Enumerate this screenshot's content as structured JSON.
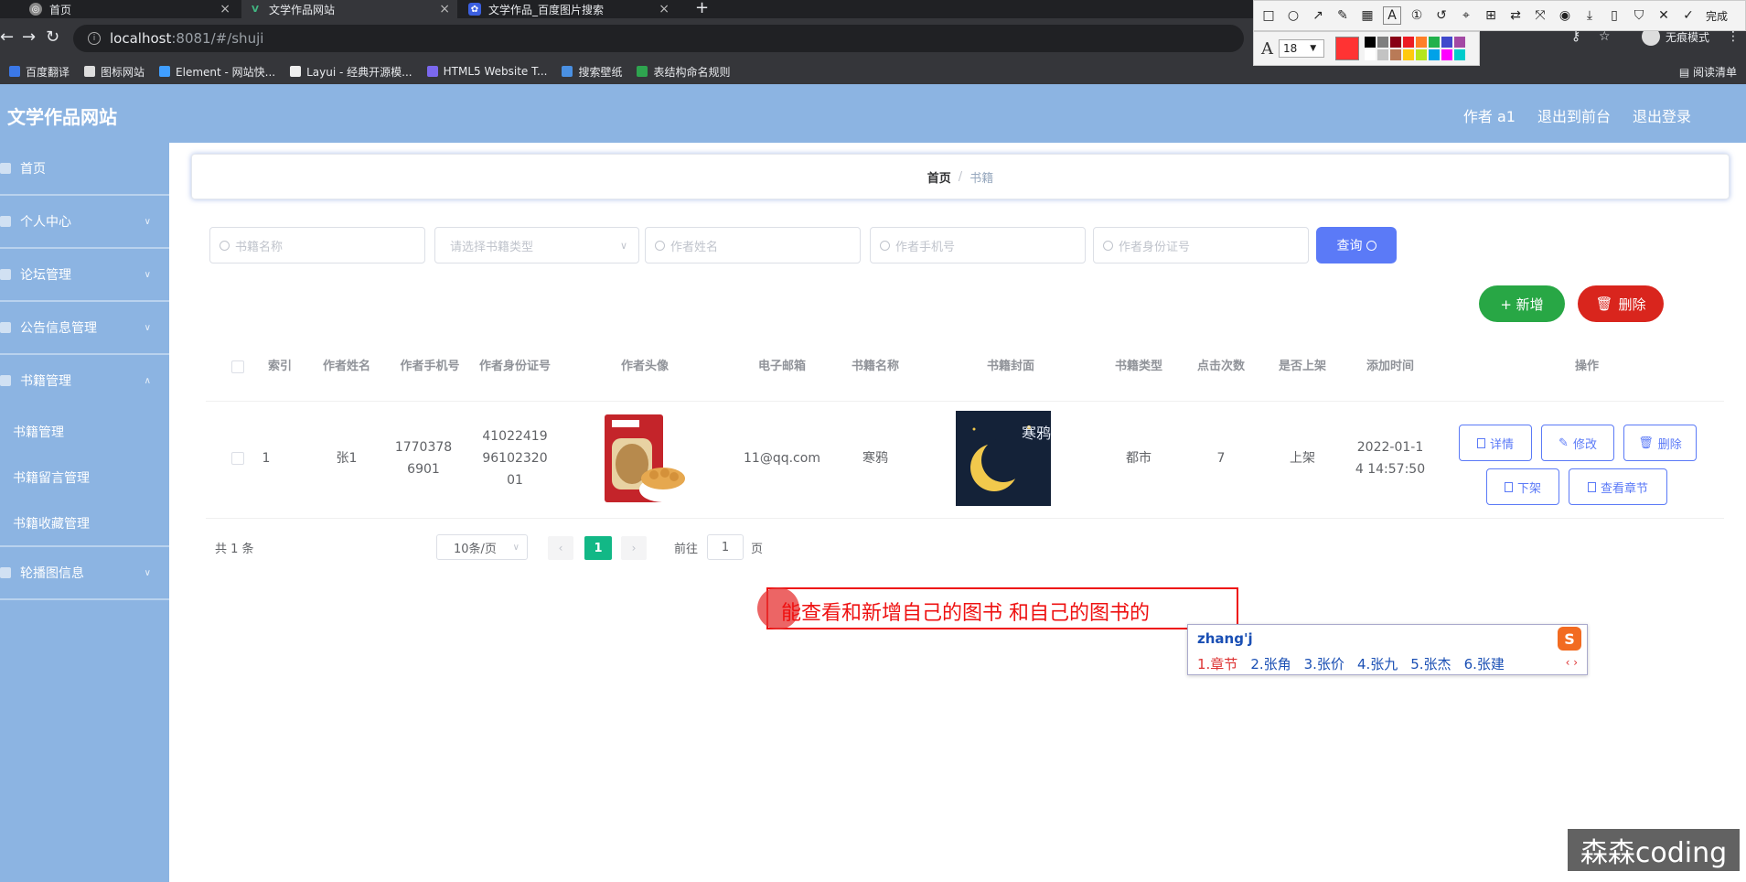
{
  "browser": {
    "tabs": [
      {
        "title": "首页",
        "active": false
      },
      {
        "title": "文学作品网站",
        "active": true
      },
      {
        "title": "文学作品_百度图片搜索",
        "active": false
      }
    ],
    "url_host": "localhost",
    "url_path": ":8081/#/shuji",
    "bookmarks": [
      "百度翻译",
      "图标网站",
      "Element - 网站快...",
      "Layui - 经典开源模...",
      "HTML5 Website T...",
      "搜索壁纸",
      "表结构命名规则"
    ],
    "reading_list": "阅读清单",
    "incognito_label": "无痕模式",
    "screenshot_tool": {
      "done_label": "完成",
      "font_size": "18",
      "current_color": "#ff3333",
      "palette": [
        "#000000",
        "#7f7f7f",
        "#880015",
        "#ed1c24",
        "#ff7f27",
        "#22b14c",
        "#3f48cc",
        "#a349a4",
        "#ffffff",
        "#c3c3c3",
        "#b97a57",
        "#ffc90e",
        "#b5e61d",
        "#00a2e8",
        "#ff00ff",
        "#00cccc"
      ]
    }
  },
  "app": {
    "title": "文学作品网站",
    "header_links": [
      "作者 a1",
      "退出到前台",
      "退出登录"
    ],
    "sidebar": {
      "items": [
        {
          "label": "首页"
        },
        {
          "label": "个人中心"
        },
        {
          "label": "论坛管理"
        },
        {
          "label": "公告信息管理"
        },
        {
          "label": "书籍管理"
        }
      ],
      "subitems": [
        "书籍管理",
        "书籍留言管理",
        "书籍收藏管理"
      ],
      "last_item": "轮播图信息"
    },
    "breadcrumb": {
      "home": "首页",
      "sep": "/",
      "current": "书籍"
    },
    "search": {
      "book_name_placeholder": "书籍名称",
      "book_type_placeholder": "请选择书籍类型",
      "author_name_placeholder": "作者姓名",
      "author_phone_placeholder": "作者手机号",
      "author_id_placeholder": "作者身份证号",
      "query_label": "查询"
    },
    "actions": {
      "add_label": "+ 新增",
      "delete_label": "删除"
    },
    "table": {
      "headers": [
        "索引",
        "作者姓名",
        "作者手机号",
        "作者身份证号",
        "作者头像",
        "电子邮箱",
        "书籍名称",
        "书籍封面",
        "书籍类型",
        "点击次数",
        "是否上架",
        "添加时间",
        "操作"
      ],
      "rows": [
        {
          "index": "1",
          "author_name": "张1",
          "author_phone": "17703786901",
          "author_id": "410224199610232001",
          "email": "11@qq.com",
          "book_name": "寒鸦",
          "cover_title": "寒鸦",
          "book_type": "都市",
          "clicks": "7",
          "on_shelf": "上架",
          "added_time": "2022-01-14 14:57:50",
          "ops": {
            "detail": "详情",
            "edit": "修改",
            "delete": "删除",
            "unshelf": "下架",
            "chapters": "查看章节"
          }
        }
      ]
    },
    "pagination": {
      "total": "共 1 条",
      "page_size": "10条/页",
      "current_page": "1",
      "goto_label": "前往",
      "goto_value": "1",
      "page_unit": "页"
    }
  },
  "overlay": {
    "annotation_text": "能查看和新增自己的图书 和自己的图书的",
    "ime_input": "zhang'j",
    "ime_candidates": [
      "1.章节",
      "2.张角",
      "3.张价",
      "4.张九",
      "5.张杰",
      "6.张建"
    ],
    "ime_logo": "S",
    "watermark": "森森coding"
  }
}
